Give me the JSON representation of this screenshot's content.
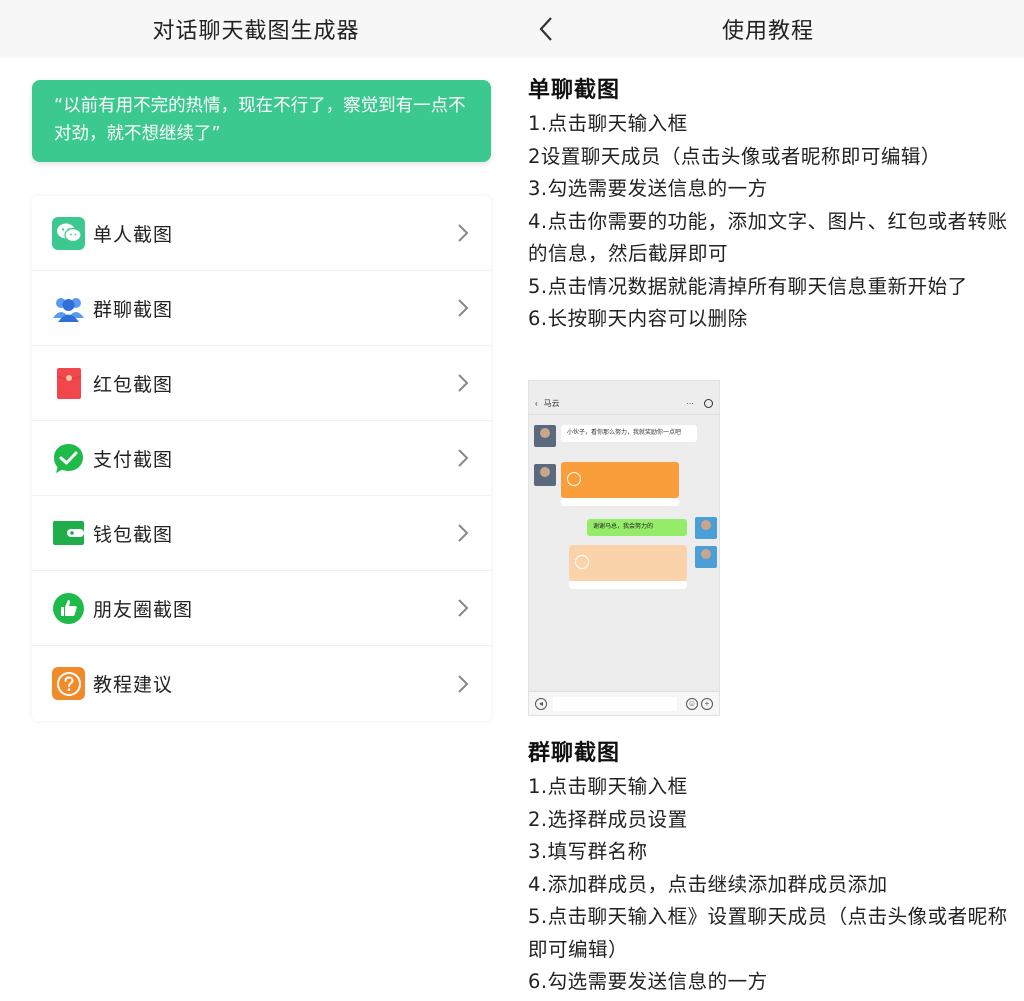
{
  "left": {
    "header_title": "对话聊天截图生成器",
    "quote": "“以前有用不完的热情，现在不行了，察觉到有一点不对劲，就不想继续了”",
    "menu": [
      {
        "label": "单人截图",
        "icon": "wechat-chat-icon",
        "color": "#3bc98f"
      },
      {
        "label": "群聊截图",
        "icon": "group-users-icon",
        "color": "#3a7de0"
      },
      {
        "label": "红包截图",
        "icon": "red-packet-icon",
        "color": "#f1474c"
      },
      {
        "label": "支付截图",
        "icon": "payment-check-icon",
        "color": "#1fbb4a"
      },
      {
        "label": "钱包截图",
        "icon": "wallet-icon",
        "color": "#1fae4a"
      },
      {
        "label": "朋友圈截图",
        "icon": "moments-like-icon",
        "color": "#1fbb4a"
      },
      {
        "label": "教程建议",
        "icon": "help-question-icon",
        "color": "#f08a2a"
      }
    ]
  },
  "right": {
    "header_title": "使用教程",
    "section1": {
      "title": "单聊截图",
      "steps": [
        "1.点击聊天输入框",
        "2设置聊天成员（点击头像或者昵称即可编辑）",
        "3.勾选需要发送信息的一方",
        "4.点击你需要的功能，添加文字、图片、红包或者转账的信息，然后截屏即可",
        "5.点击情况数据就能清掉所有聊天信息重新开始了",
        "6.长按聊天内容可以删除"
      ]
    },
    "section2": {
      "title": "群聊截图",
      "steps": [
        "1.点击聊天输入框",
        "2.选择群成员设置",
        "3.填写群名称",
        "4.添加群成员，点击继续添加群成员添加",
        "5.点击聊天输入框》设置聊天成员（点击头像或者昵称即可编辑）",
        "6.勾选需要发送信息的一方"
      ]
    },
    "phone_preview": {
      "contact_name": "马云",
      "message1": "小伙子，看你那么努力，我就奖励你一点吧",
      "message2": "谢谢马总，我会努力的"
    }
  },
  "colors": {
    "accent_green": "#3bc98f",
    "header_bg": "#f7f7f7",
    "transfer_orange": "#fa9d3b",
    "bubble_green": "#95ec69"
  }
}
